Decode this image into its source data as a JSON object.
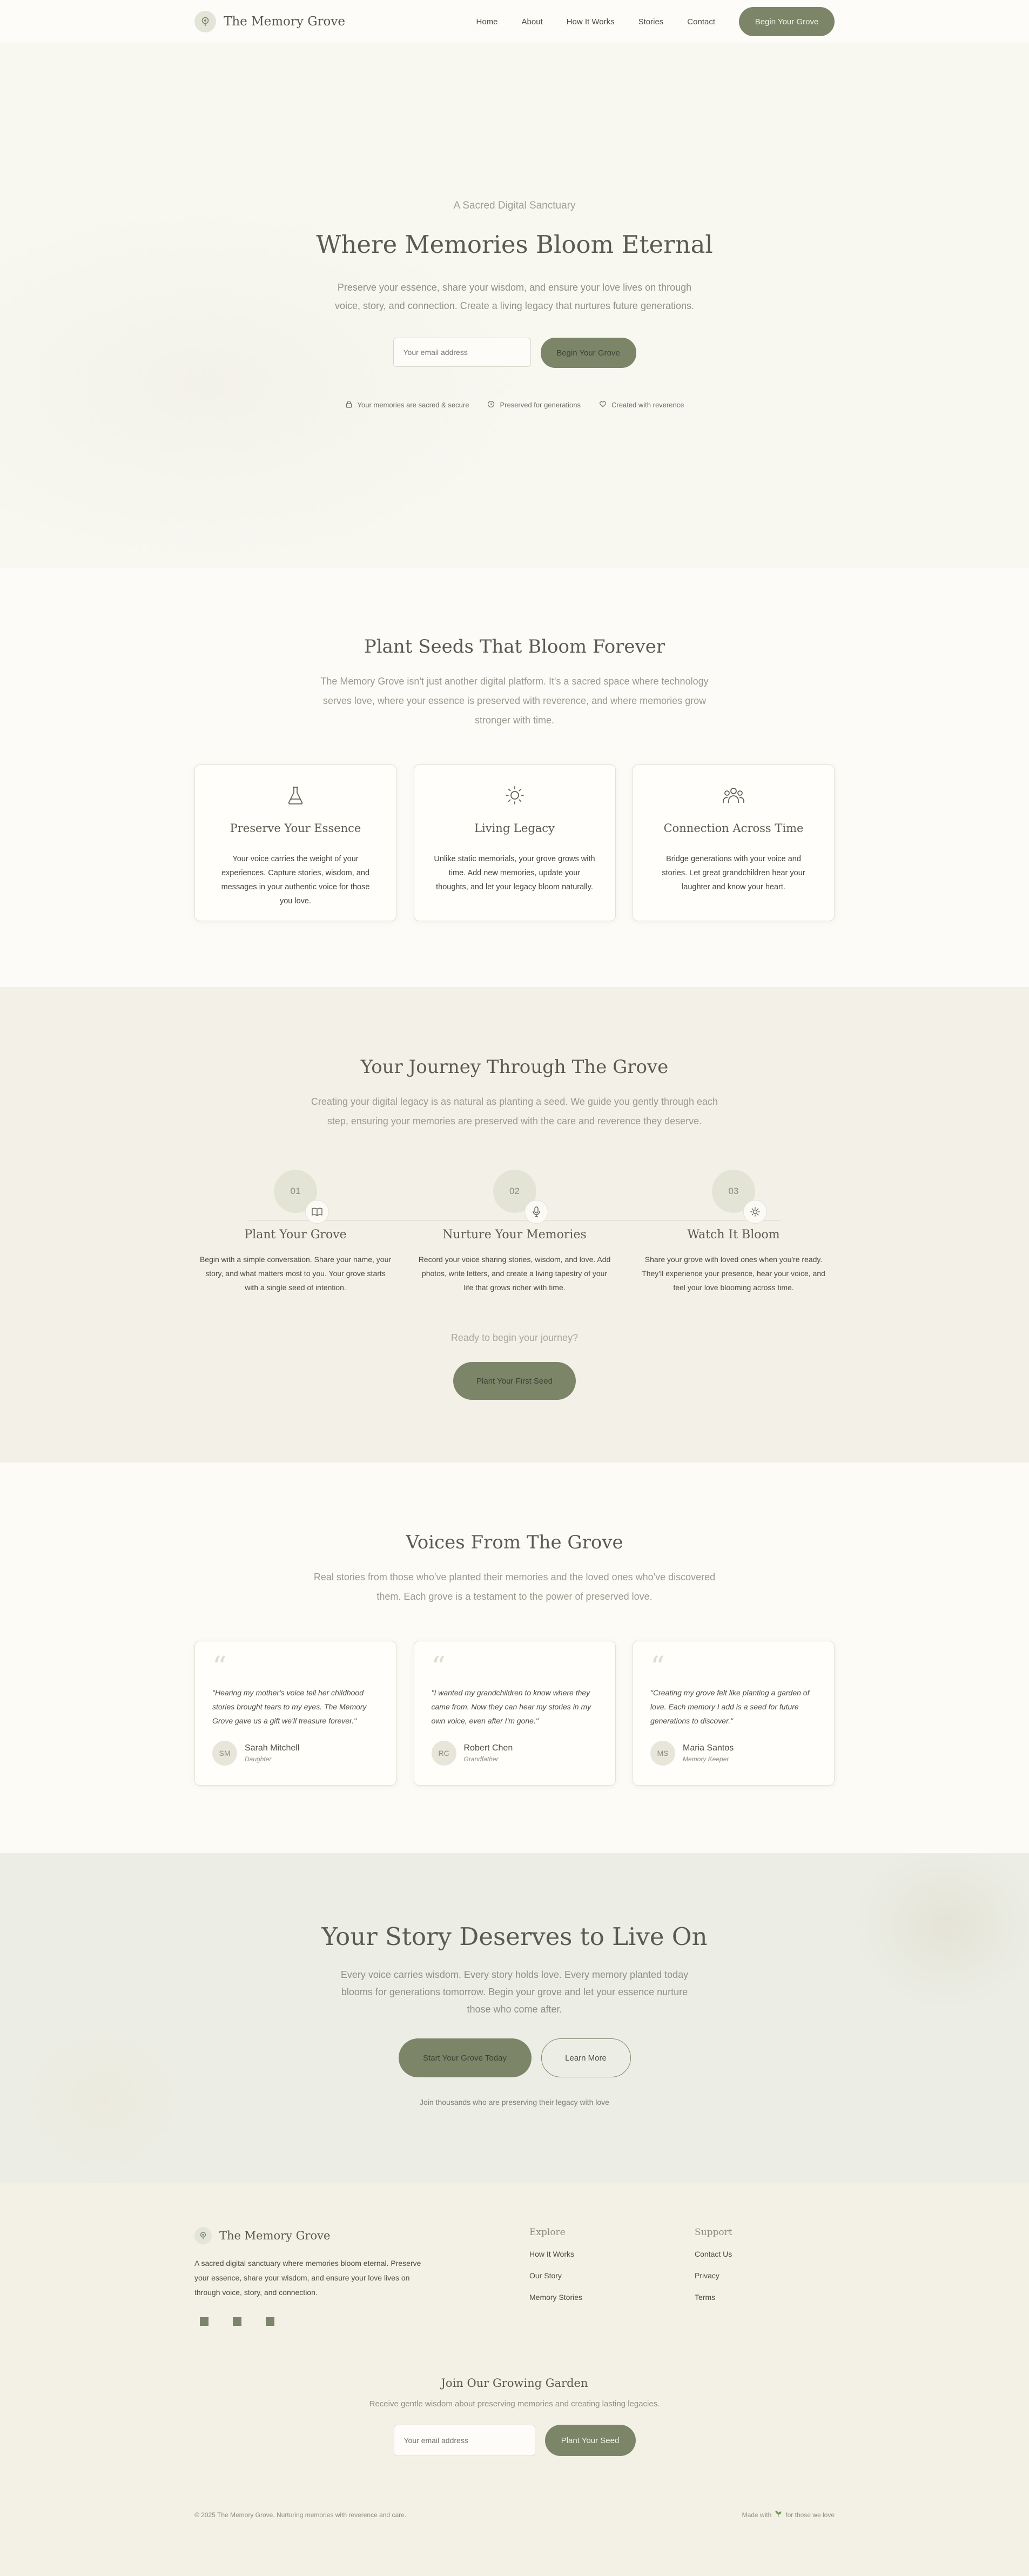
{
  "nav": {
    "brand": "The Memory Grove",
    "links": [
      "Home",
      "About",
      "How It Works",
      "Stories",
      "Contact"
    ],
    "cta": "Begin Your Grove"
  },
  "hero": {
    "eyebrow": "A Sacred Digital Sanctuary",
    "title": "Where Memories Bloom Eternal",
    "subtitle": "Preserve your essence, share your wisdom, and ensure your love lives on through voice, story, and connection. Create a living legacy that nurtures future generations.",
    "email_placeholder": "Your email address",
    "cta": "Begin Your Grove",
    "trust": [
      {
        "icon": "lock-icon",
        "text": "Your memories are sacred & secure"
      },
      {
        "icon": "clock-icon",
        "text": "Preserved for generations"
      },
      {
        "icon": "heart-icon",
        "text": "Created with reverence"
      }
    ]
  },
  "seeds": {
    "title": "Plant Seeds That Bloom Forever",
    "subtitle": "The Memory Grove isn't just another digital platform. It's a sacred space where technology serves love, where your essence is preserved with reverence, and where memories grow stronger with time.",
    "cards": [
      {
        "icon": "flask-icon",
        "title": "Preserve Your Essence",
        "text": "Your voice carries the weight of your experiences. Capture stories, wisdom, and messages in your authentic voice for those you love."
      },
      {
        "icon": "sun-icon",
        "title": "Living Legacy",
        "text": "Unlike static memorials, your grove grows with time. Add new memories, update your thoughts, and let your legacy bloom naturally."
      },
      {
        "icon": "users-icon",
        "title": "Connection Across Time",
        "text": "Bridge generations with your voice and stories. Let great grandchildren hear your laughter and know your heart."
      }
    ]
  },
  "journey": {
    "title": "Your Journey Through The Grove",
    "subtitle": "Creating your digital legacy is as natural as planting a seed. We guide you gently through each step, ensuring your memories are preserved with the care and reverence they deserve.",
    "steps": [
      {
        "num": "01",
        "icon": "book-icon",
        "title": "Plant Your Grove",
        "text": "Begin with a simple conversation. Share your name, your story, and what matters most to you. Your grove starts with a single seed of intention."
      },
      {
        "num": "02",
        "icon": "microphone-icon",
        "title": "Nurture Your Memories",
        "text": "Record your voice sharing stories, wisdom, and love. Add photos, write letters, and create a living tapestry of your life that grows richer with time."
      },
      {
        "num": "03",
        "icon": "sun-icon",
        "title": "Watch It Bloom",
        "text": "Share your grove with loved ones when you're ready. They'll experience your presence, hear your voice, and feel your love blooming across time."
      }
    ],
    "ready": "Ready to begin your journey?",
    "cta": "Plant Your First Seed"
  },
  "voices": {
    "title": "Voices From The Grove",
    "subtitle": "Real stories from those who've planted their memories and the loved ones who've discovered them. Each grove is a testament to the power of preserved love.",
    "testimonials": [
      {
        "quote": "\"Hearing my mother's voice tell her childhood stories brought tears to my eyes. The Memory Grove gave us a gift we'll treasure forever.\"",
        "initials": "SM",
        "name": "Sarah Mitchell",
        "role": "Daughter"
      },
      {
        "quote": "\"I wanted my grandchildren to know where they came from. Now they can hear my stories in my own voice, even after I'm gone.\"",
        "initials": "RC",
        "name": "Robert Chen",
        "role": "Grandfather"
      },
      {
        "quote": "\"Creating my grove felt like planting a garden of love. Each memory I add is a seed for future generations to discover.\"",
        "initials": "MS",
        "name": "Maria Santos",
        "role": "Memory Keeper"
      }
    ]
  },
  "story": {
    "title": "Your Story Deserves to Live On",
    "subtitle": "Every voice carries wisdom. Every story holds love. Every memory planted today blooms for generations tomorrow. Begin your grove and let your essence nurture those who come after.",
    "primary": "Start Your Grove Today",
    "secondary": "Learn More",
    "note": "Join thousands who are preserving their legacy with love"
  },
  "footer": {
    "brand": "The Memory Grove",
    "desc": "A sacred digital sanctuary where memories bloom eternal. Preserve your essence, share your wisdom, and ensure your love lives on through voice, story, and connection.",
    "explore_title": "Explore",
    "explore": [
      "How It Works",
      "Our Story",
      "Memory Stories"
    ],
    "support_title": "Support",
    "support": [
      "Contact Us",
      "Privacy",
      "Terms"
    ],
    "news_title": "Join Our Growing Garden",
    "news_sub": "Receive gentle wisdom about preserving memories and creating lasting legacies.",
    "news_placeholder": "Your email address",
    "news_cta": "Plant Your Seed",
    "copyright": "© 2025 The Memory Grove. Nurturing memories with reverence and care.",
    "made_prefix": "Made with",
    "made_suffix": "for those we love"
  },
  "colors": {
    "accent": "#7d8569",
    "background": "#fbfaf5",
    "section_alt": "#f3f1e7"
  }
}
